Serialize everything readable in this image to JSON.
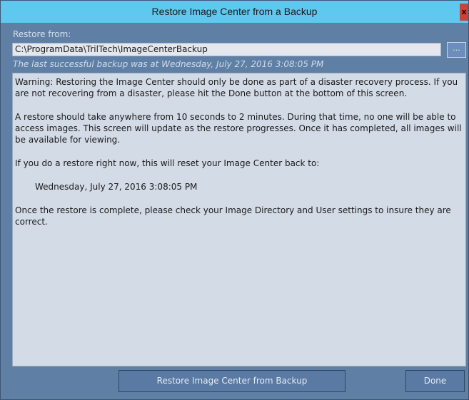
{
  "window": {
    "title": "Restore Image Center from a Backup",
    "close_glyph": "x"
  },
  "restore_from": {
    "label": "Restore from:",
    "path_value": "C:\\ProgramData\\TrilTech\\ImageCenterBackup",
    "browse_label": "..."
  },
  "last_backup_text": "The last successful backup was at Wednesday, July 27, 2016 3:08:05 PM",
  "message": {
    "warning": "Warning: Restoring the Image Center should only be done as part of a disaster recovery process. If you are not recovering from a disaster, please hit the Done button at the bottom of this screen.",
    "duration": "A restore should take anywhere from 10 seconds to 2 minutes. During that time, no one will be able to access images. This screen will update as the restore progresses. Once it has completed, all images will be available for viewing.",
    "reset_intro": "If you do a restore right now, this will reset your Image Center back to:",
    "reset_date": "Wednesday, July 27, 2016 3:08:05 PM",
    "check_settings": "Once the restore is complete, please check your Image Directory and User settings to insure they are correct."
  },
  "buttons": {
    "restore_label": "Restore Image Center from Backup",
    "done_label": "Done"
  },
  "colors": {
    "titlebar": "#5fc8ee",
    "window_bg": "#5f7fa5",
    "close_button": "#c94434",
    "message_bg": "#d3dbe6"
  }
}
